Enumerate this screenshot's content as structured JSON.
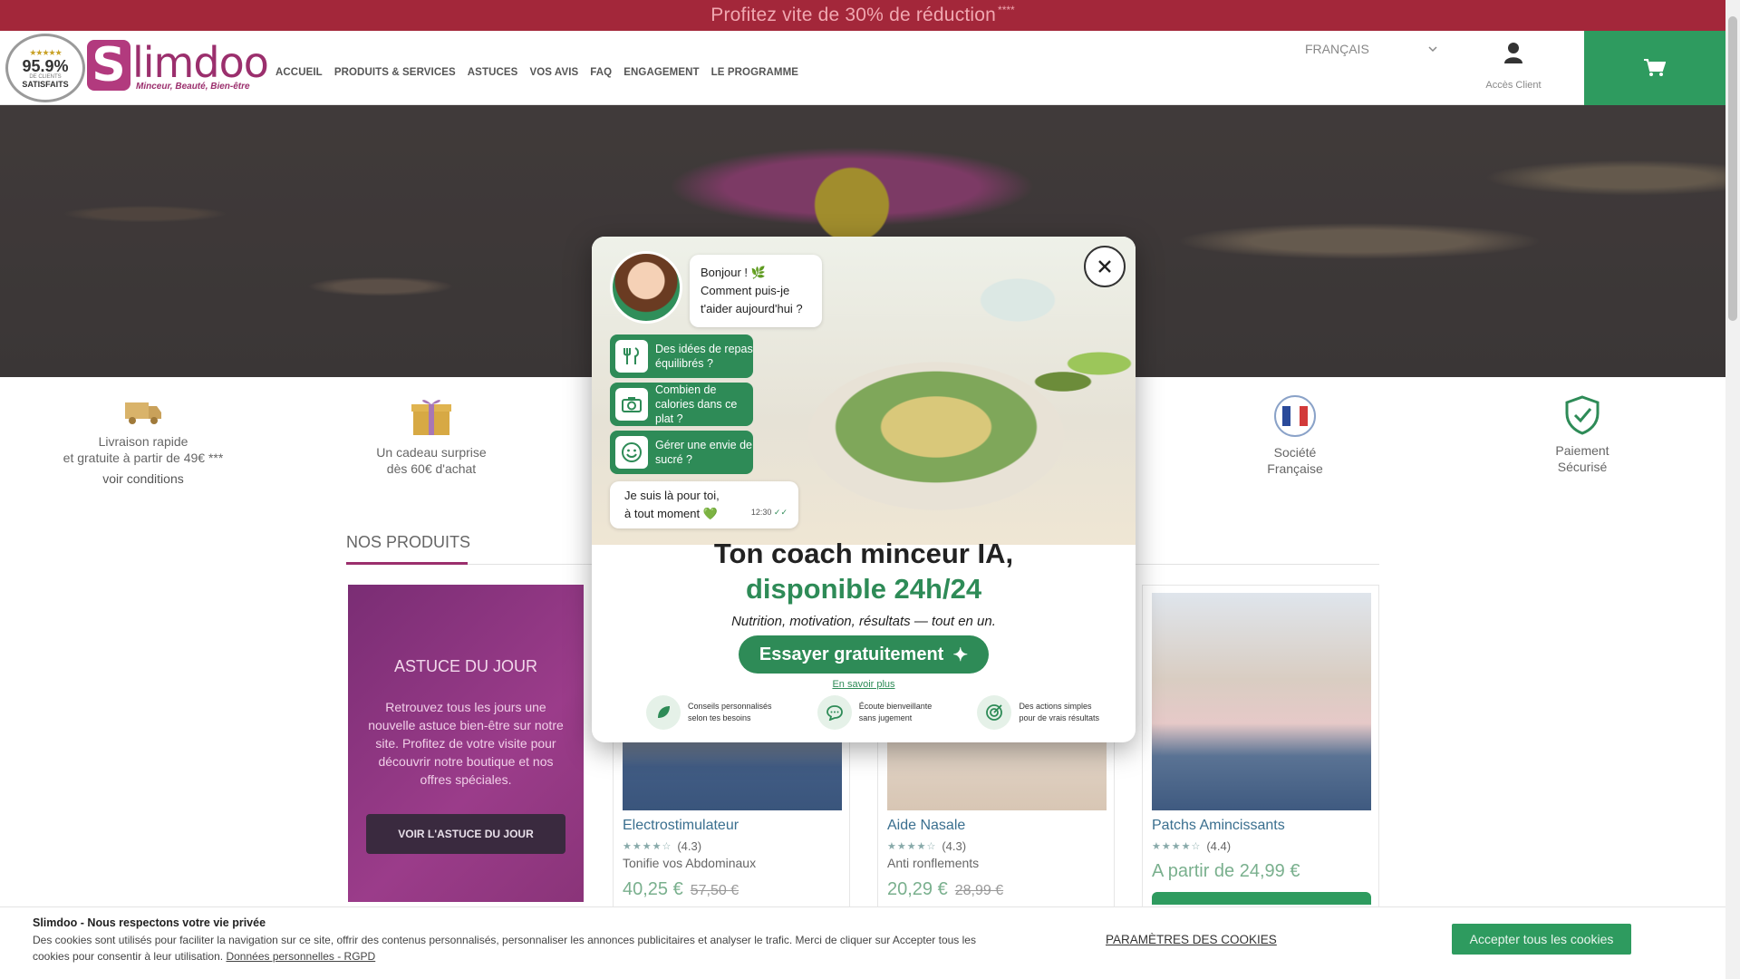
{
  "promo": {
    "text": "Profitez vite de 30% de réduction",
    "mark": "****"
  },
  "header": {
    "badge": {
      "stars": "★★★★★",
      "percent": "95.9%",
      "clients": "DE CLIENTS",
      "satisfied": "SATISFAITS"
    },
    "logo": {
      "letter": "S",
      "word": "limdoo",
      "tagline": "Minceur, Beauté, Bien-être"
    },
    "nav": [
      "ACCUEIL",
      "PRODUITS & SERVICES",
      "ASTUCES",
      "VOS AVIS",
      "FAQ",
      "ENGAGEMENT",
      "LE PROGRAMME"
    ],
    "language": "FRANÇAIS",
    "account_label": "Accès Client"
  },
  "features": [
    {
      "text1": "Livraison rapide",
      "text2": "et gratuite à partir de 49€ ***",
      "link": "voir conditions",
      "icon": "truck-icon"
    },
    {
      "text1": "Un cadeau surprise",
      "text2": "dès 60€ d'achat",
      "icon": "gift-icon"
    },
    {
      "text1": "Société",
      "text2": "Française",
      "icon": "french-flag-icon"
    },
    {
      "text1": "Paiement",
      "text2": "Sécurisé",
      "icon": "shield-check-icon"
    }
  ],
  "products_section": {
    "title": "NOS PRODUITS",
    "tip": {
      "title": "ASTUCE DU JOUR",
      "text": "Retrouvez tous les jours une nouvelle astuce bien-être sur notre site. Profitez de votre visite pour découvrir notre boutique et nos offres spéciales.",
      "button": "VOIR L'ASTUCE DU JOUR"
    },
    "products": [
      {
        "name": "Electrostimulateur",
        "rating": "(4.3)",
        "rating_value": 4.3,
        "desc": "Tonifie vos Abdominaux",
        "price": "40,25 €",
        "old_price": "57,50 €"
      },
      {
        "name": "Aide Nasale",
        "rating": "(4.3)",
        "rating_value": 4.3,
        "desc": "Anti ronflements",
        "price": "20,29 €",
        "old_price": "28,99 €"
      },
      {
        "name": "Patchs Amincissants",
        "rating": "(4.4)",
        "rating_value": 4.4,
        "desc": "",
        "price": "A partir de 24,99 €",
        "old_price": ""
      }
    ]
  },
  "modal": {
    "greeting_line1": "Bonjour ! 🌿",
    "greeting_line2": "Comment puis-je t'aider aujourd'hui ?",
    "chips": [
      {
        "label": "Des idées de repas équilibrés ?",
        "icon": "fork-knife-icon"
      },
      {
        "label": "Combien de calories dans ce plat ?",
        "icon": "camera-icon"
      },
      {
        "label": "Gérer une envie de sucré ?",
        "icon": "smile-icon"
      }
    ],
    "reply_line1": "Je suis là pour toi,",
    "reply_line2": "à tout moment 💚",
    "reply_time": "12:30",
    "headline": "Ton coach minceur IA,",
    "headline2": "disponible 24h/24",
    "subline": "Nutrition, motivation, résultats — tout en un.",
    "cta": "Essayer gratuitement",
    "more": "En savoir plus",
    "benefits": [
      {
        "line1": "Conseils personnalisés",
        "line2": "selon tes besoins",
        "icon": "leaf-icon"
      },
      {
        "line1": "Écoute bienveillante",
        "line2": "sans jugement",
        "icon": "chat-icon"
      },
      {
        "line1": "Des actions simples",
        "line2": "pour de vrais résultats",
        "icon": "target-icon"
      }
    ]
  },
  "cookie": {
    "title": "Slimdoo - Nous respectons votre vie privée",
    "body": "Des cookies sont utilisés pour faciliter la navigation sur ce site, offrir des contenus personnalisés, personnaliser les annonces publicitaires et analyser le trafic. Merci de cliquer sur Accepter tous les cookies pour consentir à leur utilisation.",
    "link": "Données personnelles - RGPD",
    "params": "PARAMÈTRES DES COOKIES",
    "accept": "Accepter tous les cookies"
  },
  "colors": {
    "brand": "#9b2f6d",
    "green": "#2e9b5f",
    "promo": "#a3273a"
  }
}
